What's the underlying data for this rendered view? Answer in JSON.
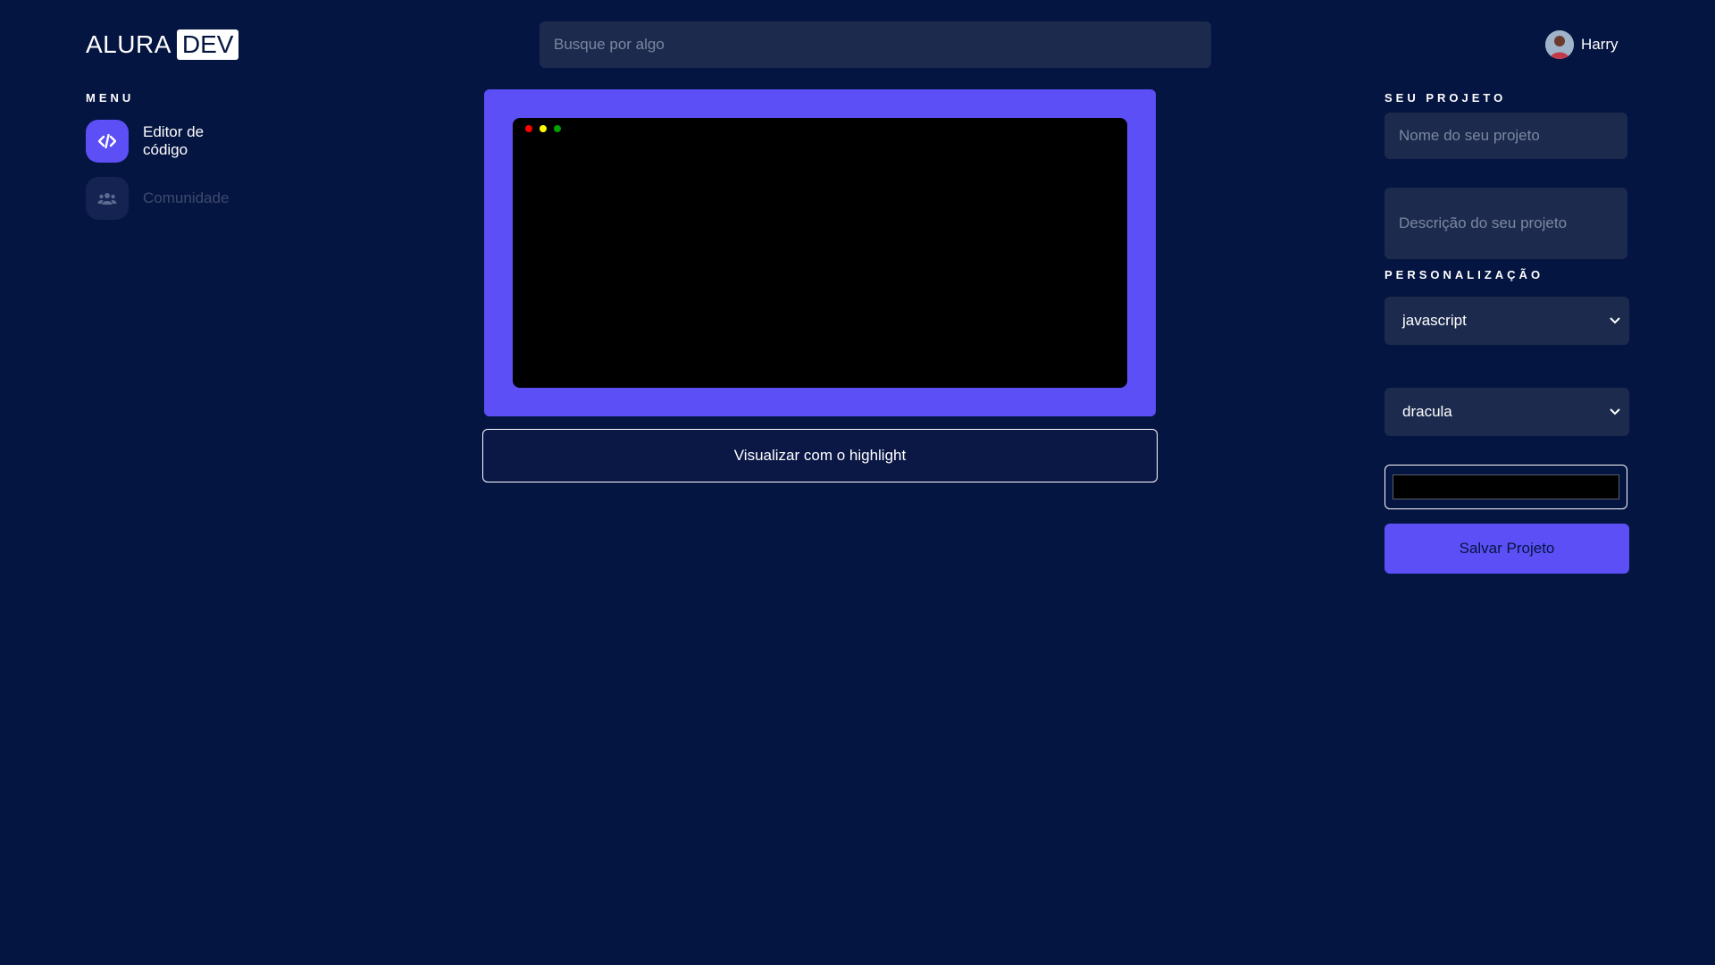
{
  "header": {
    "logo_text": "ALURA",
    "logo_badge": "DEV",
    "search_placeholder": "Busque por algo",
    "user_name": "Harry"
  },
  "sidebar": {
    "title": "MENU",
    "items": [
      {
        "label": "Editor de código",
        "icon": "code-icon",
        "active": true
      },
      {
        "label": "Comunidade",
        "icon": "people-icon",
        "active": false
      }
    ]
  },
  "editor": {
    "window_dots": [
      "#ff0000",
      "#ffff00",
      "#00a000"
    ],
    "frame_color": "#5b4ff5",
    "highlight_button": "Visualizar com o highlight"
  },
  "project": {
    "title": "SEU PROJETO",
    "name_placeholder": "Nome do seu projeto",
    "description_placeholder": "Descrição do seu projeto"
  },
  "customization": {
    "title": "PERSONALIZAÇÃO",
    "language": "javascript",
    "theme": "dracula",
    "color": "#000000",
    "save_button": "Salvar Projeto"
  },
  "colors": {
    "background": "#051541",
    "accent": "#5b4ff5",
    "field": "#1c2a4e"
  }
}
